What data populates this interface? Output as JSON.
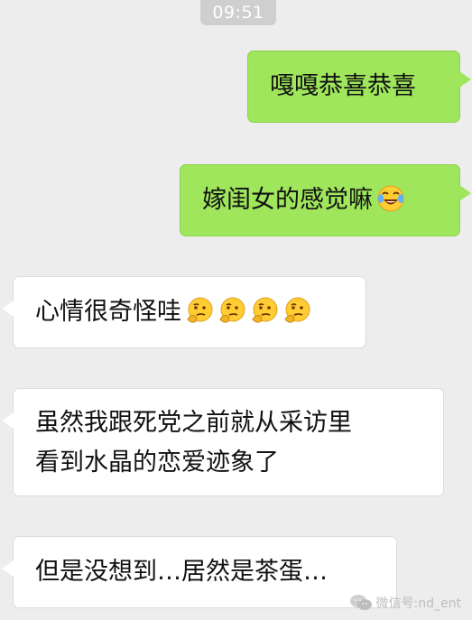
{
  "status": {
    "time": "09:51"
  },
  "messages": [
    {
      "side": "sent",
      "text": "嘎嘎恭喜恭喜"
    },
    {
      "side": "sent",
      "text": "嫁闺女的感觉嘛",
      "emoji": "laugh-cry-emoji"
    },
    {
      "side": "recv",
      "text": "心情很奇怪哇",
      "emoji": "thinking-emoji",
      "emoji_count": 4
    },
    {
      "side": "recv",
      "lines": [
        "虽然我跟死党之前就从采访里",
        "看到水晶的恋爱迹象了"
      ]
    },
    {
      "side": "recv",
      "text": "但是没想到…居然是茶蛋…"
    }
  ],
  "watermark": {
    "text": "微信号:nd_ent",
    "icon": "wechat-icon"
  },
  "colors": {
    "background": "#ededed",
    "sent_bubble": "#9fe65c",
    "recv_bubble": "#ffffff",
    "timestamp_bg": "#cfcfcf"
  }
}
